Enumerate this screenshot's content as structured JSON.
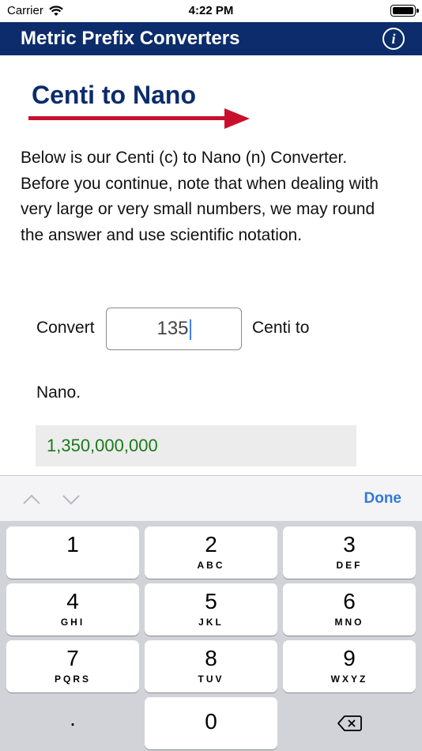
{
  "status": {
    "carrier": "Carrier",
    "time": "4:22 PM"
  },
  "nav": {
    "title": "Metric Prefix Converters",
    "info_icon": "i"
  },
  "banner": {
    "title": "Centi to Nano",
    "arrow_color": "#c8102e"
  },
  "description": "Below is our Centi (c) to Nano (n) Converter. Before you continue, note that when dealing with very large or very small numbers, we may round the answer and use scientific notation.",
  "converter": {
    "label": "Convert",
    "input_value": "135",
    "from_unit": "Centi to",
    "to_unit": "Nano.",
    "result": "1,350,000,000"
  },
  "accessory": {
    "done_label": "Done"
  },
  "keyboard": {
    "keys": [
      {
        "digit": "1",
        "letters": ""
      },
      {
        "digit": "2",
        "letters": "ABC"
      },
      {
        "digit": "3",
        "letters": "DEF"
      },
      {
        "digit": "4",
        "letters": "GHI"
      },
      {
        "digit": "5",
        "letters": "JKL"
      },
      {
        "digit": "6",
        "letters": "MNO"
      },
      {
        "digit": "7",
        "letters": "PQRS"
      },
      {
        "digit": "8",
        "letters": "TUV"
      },
      {
        "digit": "9",
        "letters": "WXYZ"
      }
    ],
    "dot": ".",
    "zero": "0"
  },
  "colors": {
    "nav_background": "#0c2c6b",
    "result_text": "#1a7a1a",
    "done_button": "#2f7bd6"
  }
}
